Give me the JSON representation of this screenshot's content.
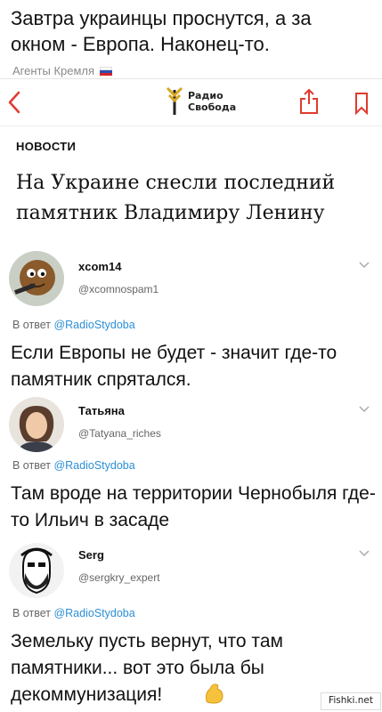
{
  "post": {
    "title": "Завтра украинцы проснутся, а за окном - Европа. Наконец-то.",
    "source": "Агенты Кремля"
  },
  "article_card": {
    "logo_line1": "Радио",
    "logo_line2": "Свобода",
    "section": "НОВОСТИ",
    "headline": "На Украине снесли последний памятник Владимиру Ленину"
  },
  "replies": [
    {
      "name": "xcom14",
      "handle": "@xcomnospam1",
      "reply_label": "В ответ",
      "reply_to": "@RadioStydoba",
      "text": "Если Европы не будет - значит где-то памятник спрятался."
    },
    {
      "name": "Татьяна",
      "handle": "@Tatyana_riches",
      "reply_label": "В ответ",
      "reply_to": "@RadioStydoba",
      "text": "Там вроде на территории Чернобыля где-то Ильич в засаде"
    },
    {
      "name": "Serg",
      "handle": "@sergkry_expert",
      "reply_label": "В ответ",
      "reply_to": "@RadioStydoba",
      "text": "Земельку пусть вернут, что там памятники... вот это была бы декоммунизация!"
    }
  ],
  "watermark": "Fishki.net",
  "colors": {
    "mention": "#2b8fd6",
    "muted": "#666666",
    "logo_gold": "#d7a51e"
  }
}
